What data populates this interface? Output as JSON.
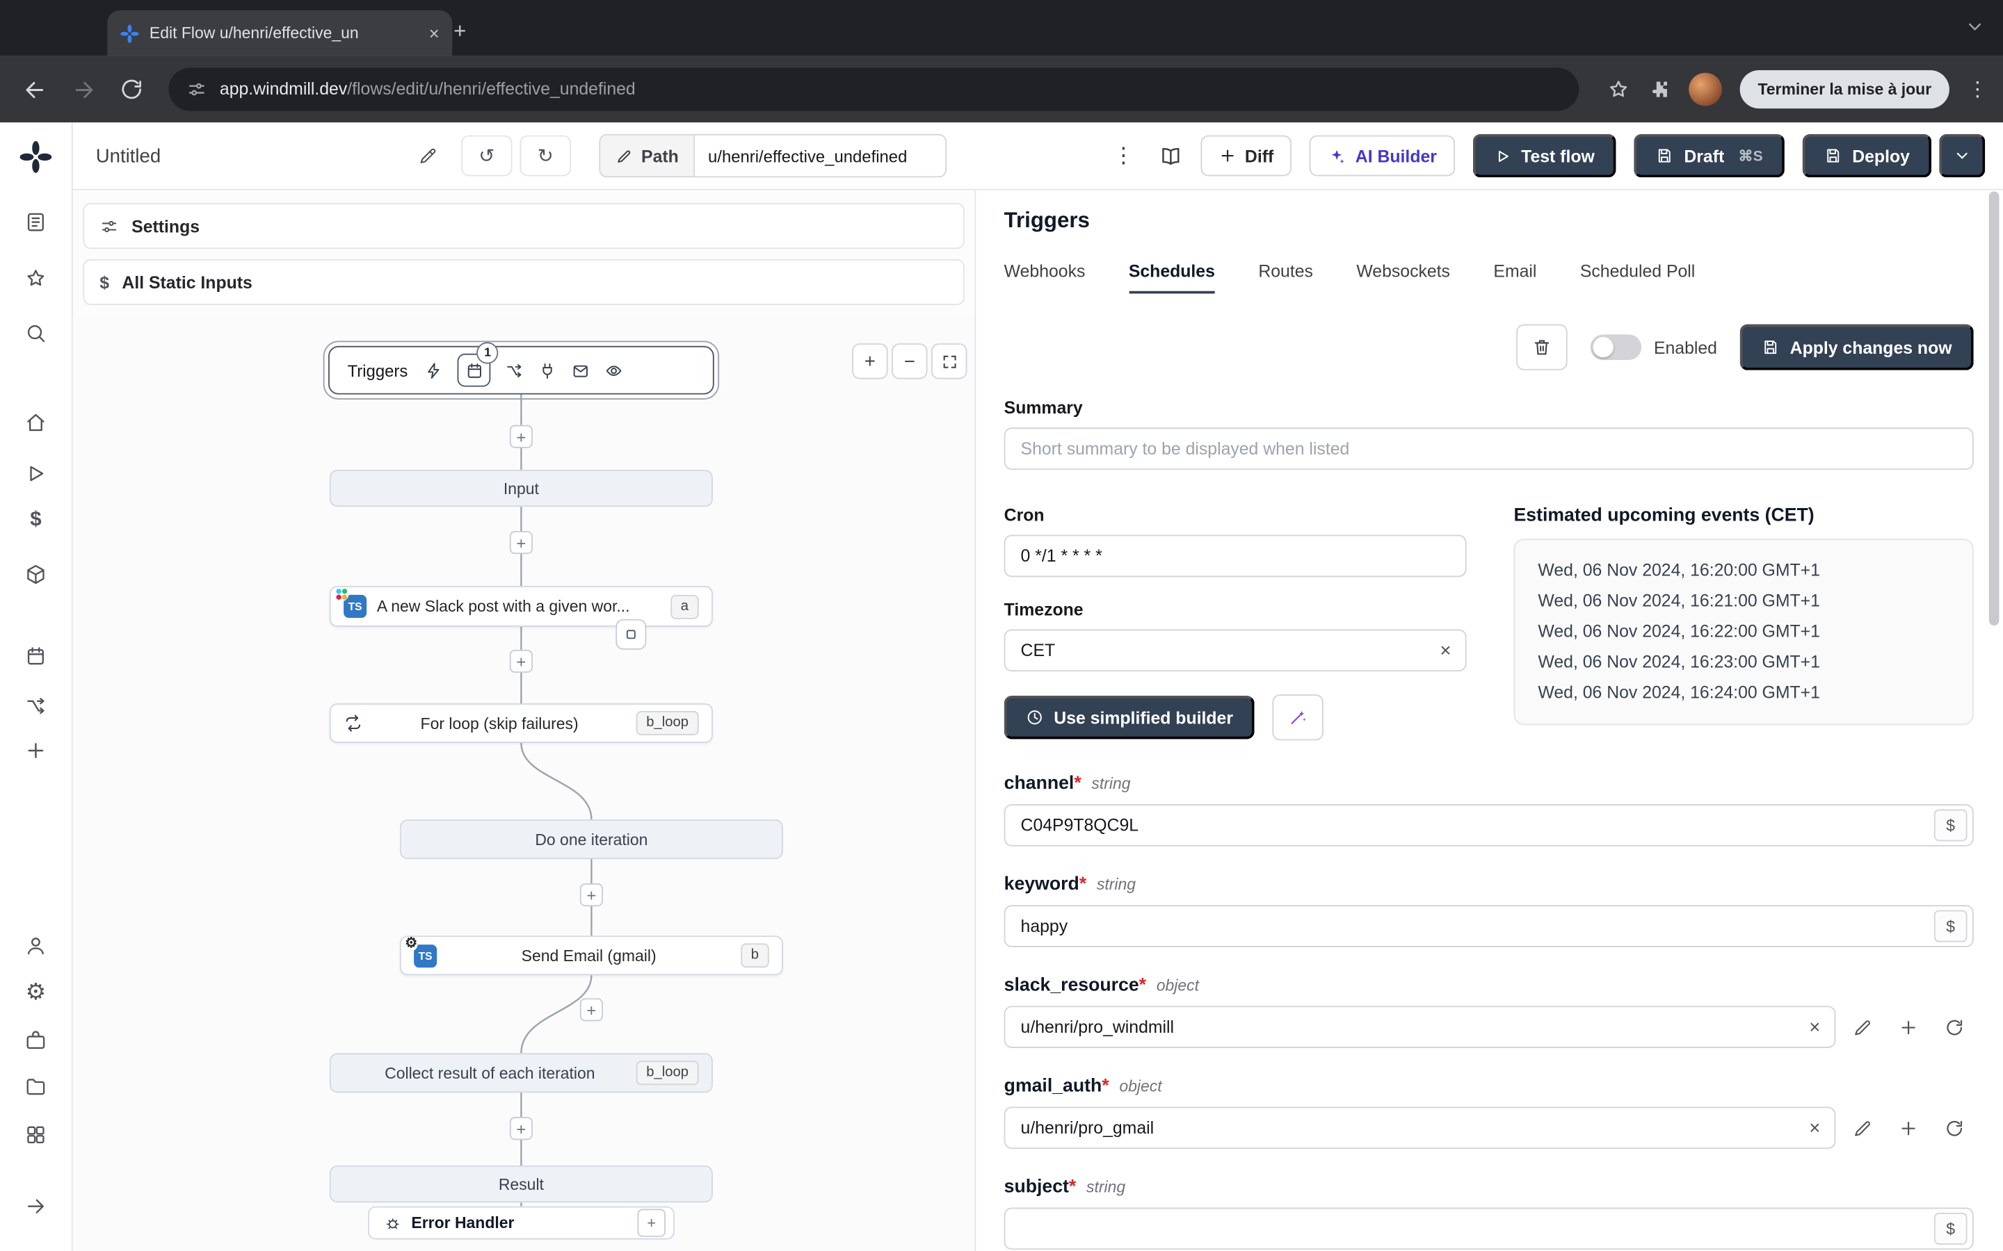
{
  "ui": {
    "required_mark": "*"
  },
  "browser": {
    "tab_title": "Edit Flow u/henri/effective_un",
    "url_domain": "app.windmill.dev",
    "url_path": "/flows/edit/u/henri/effective_undefined",
    "update_button": "Terminer la mise à jour"
  },
  "flowbar": {
    "flow_name": "Untitled",
    "path_label": "Path",
    "path_value": "u/henri/effective_undefined",
    "diff": "Diff",
    "ai_builder": "AI Builder",
    "test_flow": "Test flow",
    "draft": "Draft",
    "draft_shortcut": "⌘S",
    "deploy": "Deploy"
  },
  "left_panel": {
    "settings": "Settings",
    "all_static_inputs": "All Static Inputs"
  },
  "canvas": {
    "triggers_label": "Triggers",
    "schedule_count": "1",
    "input_node": "Input",
    "slack_node": "A new Slack post with a given wor...",
    "slack_badge": "a",
    "forloop_node": "For loop (skip failures)",
    "forloop_badge": "b_loop",
    "iteration_node": "Do one iteration",
    "email_node": "Send Email (gmail)",
    "email_badge": "b",
    "collect_node": "Collect result of each iteration",
    "collect_badge": "b_loop",
    "result_node": "Result",
    "error_handler": "Error Handler"
  },
  "panel": {
    "title": "Triggers",
    "tabs": [
      "Webhooks",
      "Schedules",
      "Routes",
      "Websockets",
      "Email",
      "Scheduled Poll"
    ],
    "enabled_label": "Enabled",
    "apply_button": "Apply changes now",
    "summary_label": "Summary",
    "summary_placeholder": "Short summary to be displayed when listed",
    "cron_label": "Cron",
    "cron_value": "0 */1 * * * *",
    "timezone_label": "Timezone",
    "timezone_value": "CET",
    "builder_button": "Use simplified builder",
    "events_title": "Estimated upcoming events (CET)",
    "events": [
      "Wed, 06 Nov 2024, 16:20:00 GMT+1",
      "Wed, 06 Nov 2024, 16:21:00 GMT+1",
      "Wed, 06 Nov 2024, 16:22:00 GMT+1",
      "Wed, 06 Nov 2024, 16:23:00 GMT+1",
      "Wed, 06 Nov 2024, 16:24:00 GMT+1"
    ],
    "fields": {
      "channel": {
        "label": "channel",
        "type": "string",
        "value": "C04P9T8QC9L"
      },
      "keyword": {
        "label": "keyword",
        "type": "string",
        "value": "happy"
      },
      "slack_resource": {
        "label": "slack_resource",
        "type": "object",
        "value": "u/henri/pro_windmill"
      },
      "gmail_auth": {
        "label": "gmail_auth",
        "type": "object",
        "value": "u/henri/pro_gmail"
      },
      "subject": {
        "label": "subject",
        "type": "string",
        "value": ""
      }
    }
  }
}
